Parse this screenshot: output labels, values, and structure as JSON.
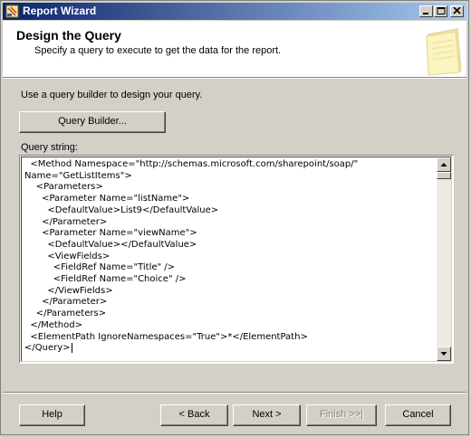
{
  "window": {
    "title": "Report Wizard"
  },
  "header": {
    "title": "Design the Query",
    "subtitle": "Specify a query to execute to get the data for the report."
  },
  "main": {
    "instruction": "Use a query builder to design your query.",
    "query_builder_label": "Query Builder...",
    "query_string_label": "Query string:",
    "query_lines": [
      "<Method Namespace=\"http://schemas.microsoft.com/sharepoint/soap/\"",
      "Name=\"GetListItems\">",
      "    <Parameters>",
      "      <Parameter Name=\"listName\">",
      "        <DefaultValue>List9</DefaultValue>",
      "      </Parameter>",
      "      <Parameter Name=\"viewName\">",
      "        <DefaultValue></DefaultValue>",
      "        <ViewFields>",
      "          <FieldRef Name=\"Title\" />",
      "          <FieldRef Name=\"Choice\" />",
      "        </ViewFields>",
      "      </Parameter>",
      "    </Parameters>",
      "  </Method>",
      "  <ElementPath IgnoreNamespaces=\"True\">*</ElementPath>",
      "</Query>"
    ]
  },
  "footer": {
    "help": "Help",
    "back": "< Back",
    "next": "Next >",
    "finish": "Finish >>|",
    "cancel": "Cancel"
  },
  "icons": {
    "app": "report-wizard-icon",
    "header": "notepad-icon",
    "minimize": "minimize-icon",
    "maximize": "maximize-icon",
    "close": "close-icon"
  }
}
